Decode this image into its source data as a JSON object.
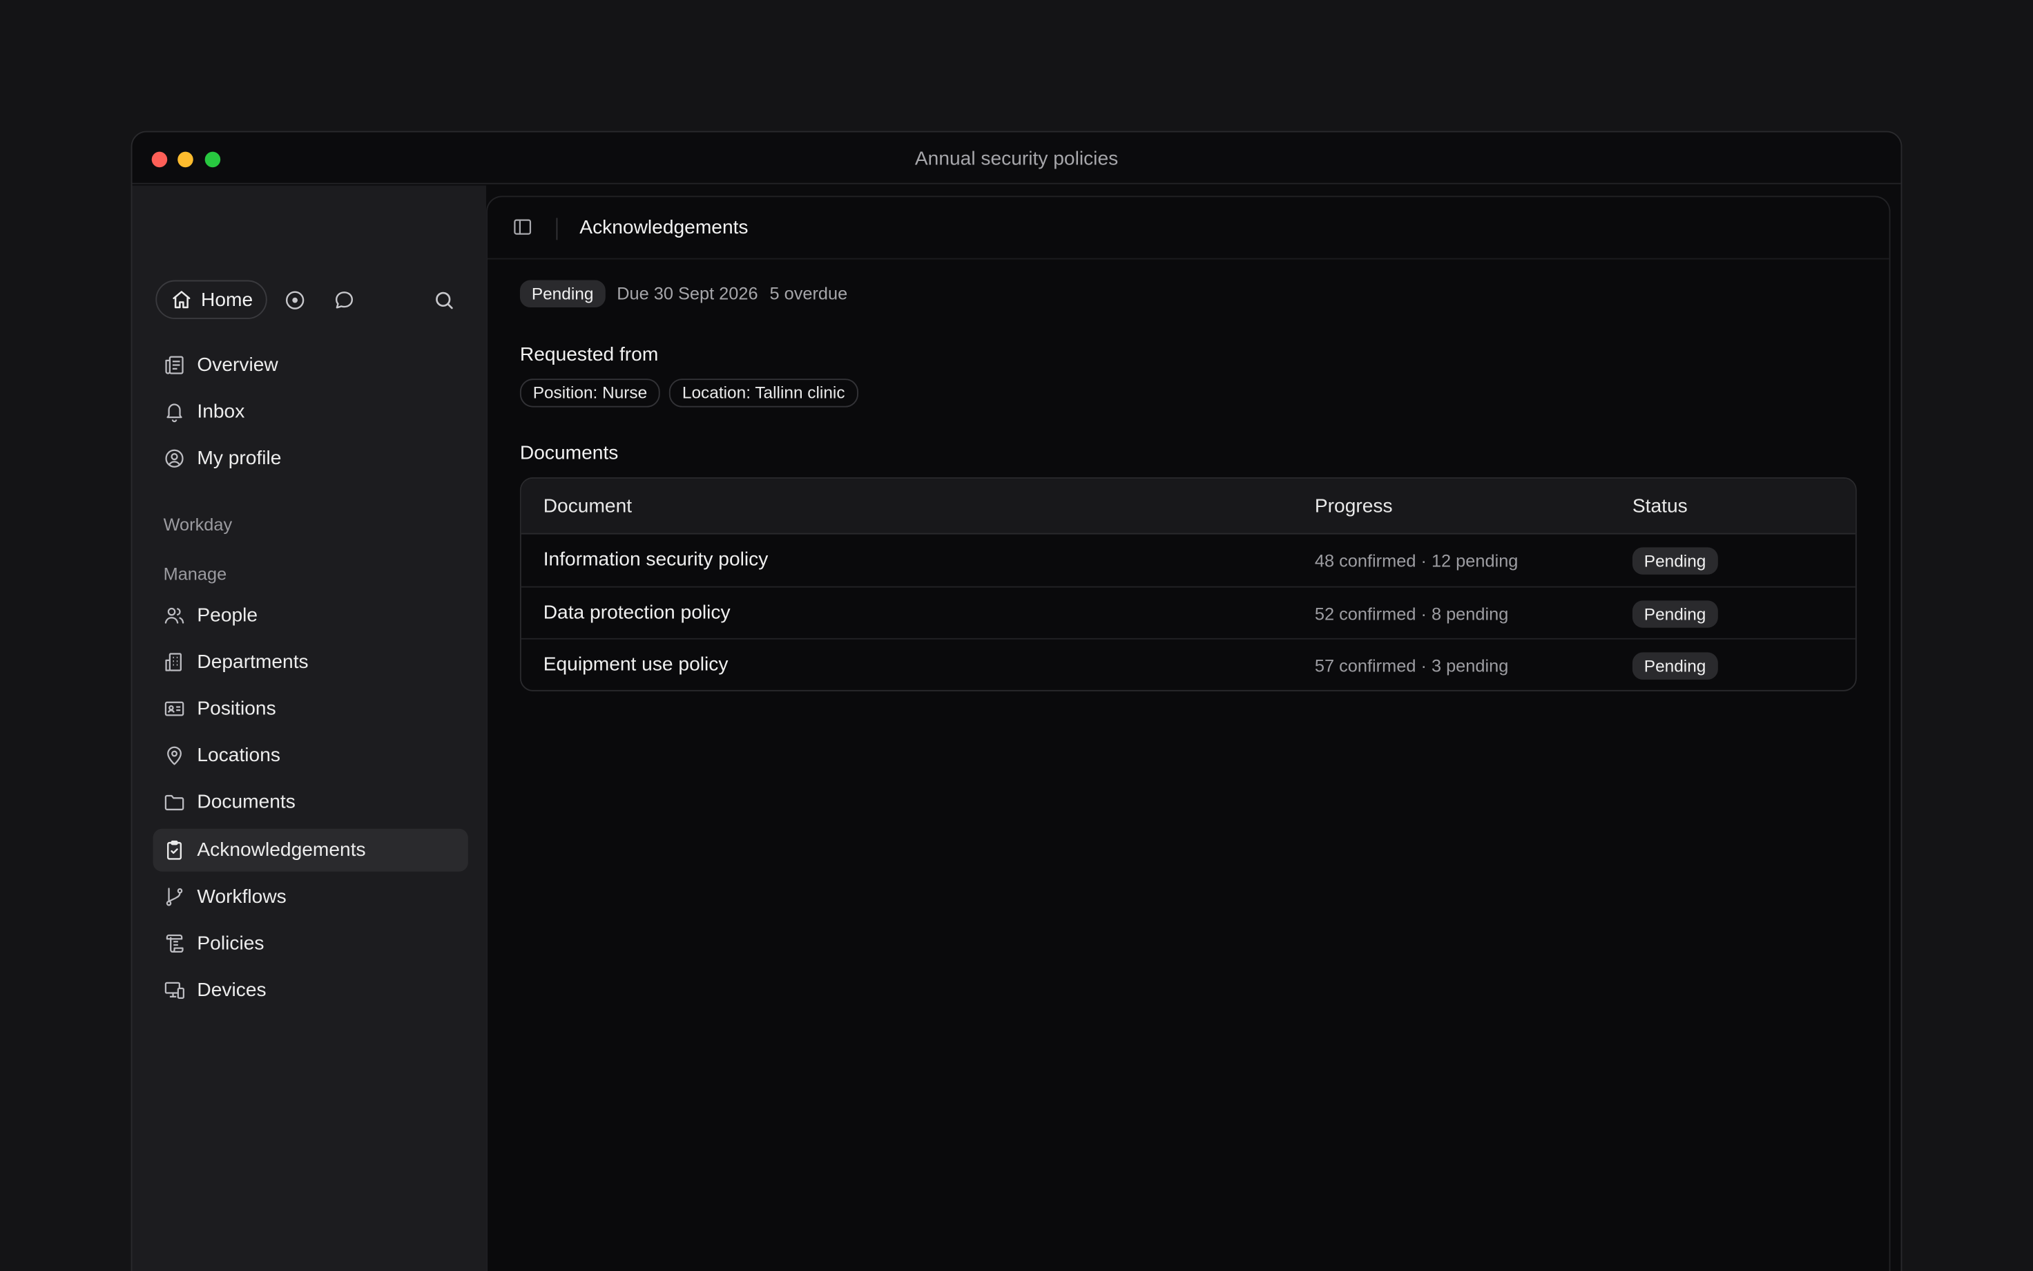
{
  "window": {
    "title": "Annual security policies"
  },
  "sidebar": {
    "home_label": "Home",
    "top_items": [
      {
        "label": "Overview",
        "icon": "overview-icon"
      },
      {
        "label": "Inbox",
        "icon": "bell-icon"
      },
      {
        "label": "My profile",
        "icon": "user-circle-icon"
      }
    ],
    "workday_label": "Workday",
    "manage_label": "Manage",
    "manage_items": [
      {
        "label": "People",
        "icon": "people-icon"
      },
      {
        "label": "Departments",
        "icon": "building-icon"
      },
      {
        "label": "Positions",
        "icon": "id-card-icon"
      },
      {
        "label": "Locations",
        "icon": "map-pin-icon"
      },
      {
        "label": "Documents",
        "icon": "folder-icon"
      },
      {
        "label": "Acknowledgements",
        "icon": "clipboard-check-icon",
        "active": true
      },
      {
        "label": "Workflows",
        "icon": "git-branch-icon"
      },
      {
        "label": "Policies",
        "icon": "scroll-icon"
      },
      {
        "label": "Devices",
        "icon": "devices-icon"
      }
    ]
  },
  "main": {
    "title": "Acknowledgements",
    "status_badge": "Pending",
    "due": "Due 30 Sept 2026",
    "overdue": "5 overdue",
    "requested_from_heading": "Requested from",
    "requested_from": [
      "Position: Nurse",
      "Location: Tallinn clinic"
    ],
    "documents_heading": "Documents",
    "table": {
      "columns": [
        "Document",
        "Progress",
        "Status"
      ],
      "rows": [
        {
          "document": "Information security policy",
          "progress": "48 confirmed · 12 pending",
          "status": "Pending"
        },
        {
          "document": "Data protection policy",
          "progress": "52 confirmed · 8 pending",
          "status": "Pending"
        },
        {
          "document": "Equipment use policy",
          "progress": "57 confirmed · 3 pending",
          "status": "Pending"
        }
      ]
    }
  }
}
